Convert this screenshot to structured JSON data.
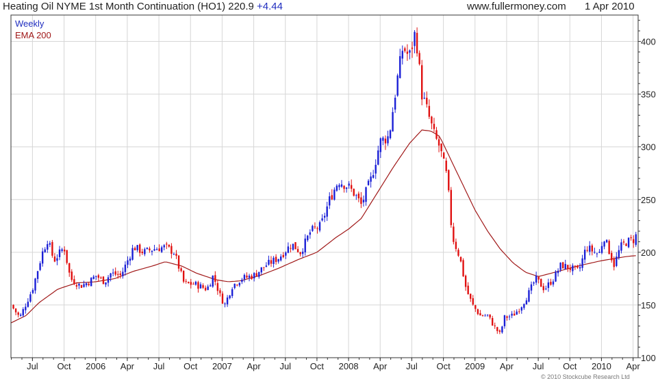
{
  "header": {
    "title": "Heating Oil NYME 1st Month Continuation (HO1) 220.9",
    "change": "+4.44",
    "site": "www.fullermoney.com",
    "date": "1 Apr 2010"
  },
  "copyright": "© 2010 Stockcube Research Ltd",
  "colors": {
    "up": "#1a1fd6",
    "down": "#e01010",
    "ema": "#a01818",
    "grid": "#d6d6d6",
    "legend_weekly": "#1f2dbf",
    "legend_ema": "#a01818"
  },
  "chart_data": {
    "type": "candlestick",
    "frequency": "weekly",
    "ylim": [
      100,
      425
    ],
    "yticks": [
      100,
      150,
      200,
      250,
      300,
      350,
      400
    ],
    "x_range": [
      2005.33,
      2010.29
    ],
    "grid": true,
    "legend_position": "top-left",
    "xticks": [
      {
        "label": "Jul",
        "t": 2005.5
      },
      {
        "label": "Oct",
        "t": 2005.75
      },
      {
        "label": "2006",
        "t": 2006.0
      },
      {
        "label": "Apr",
        "t": 2006.25
      },
      {
        "label": "Jul",
        "t": 2006.5
      },
      {
        "label": "Oct",
        "t": 2006.75
      },
      {
        "label": "2007",
        "t": 2007.0
      },
      {
        "label": "Apr",
        "t": 2007.25
      },
      {
        "label": "Jul",
        "t": 2007.5
      },
      {
        "label": "Oct",
        "t": 2007.75
      },
      {
        "label": "2008",
        "t": 2008.0
      },
      {
        "label": "Apr",
        "t": 2008.25
      },
      {
        "label": "Jul",
        "t": 2008.5
      },
      {
        "label": "Oct",
        "t": 2008.75
      },
      {
        "label": "2009",
        "t": 2009.0
      },
      {
        "label": "Apr",
        "t": 2009.25
      },
      {
        "label": "Jul",
        "t": 2009.5
      },
      {
        "label": "Oct",
        "t": 2009.75
      },
      {
        "label": "2010",
        "t": 2010.0
      },
      {
        "label": "Apr",
        "t": 2010.25
      }
    ],
    "price_path": [
      [
        2005.33,
        150
      ],
      [
        2005.4,
        138
      ],
      [
        2005.5,
        165
      ],
      [
        2005.58,
        200
      ],
      [
        2005.62,
        212
      ],
      [
        2005.67,
        192
      ],
      [
        2005.75,
        205
      ],
      [
        2005.8,
        175
      ],
      [
        2005.88,
        168
      ],
      [
        2005.95,
        172
      ],
      [
        2006.0,
        178
      ],
      [
        2006.07,
        172
      ],
      [
        2006.12,
        180
      ],
      [
        2006.2,
        178
      ],
      [
        2006.3,
        205
      ],
      [
        2006.38,
        200
      ],
      [
        2006.45,
        203
      ],
      [
        2006.55,
        205
      ],
      [
        2006.62,
        200
      ],
      [
        2006.7,
        170
      ],
      [
        2006.78,
        170
      ],
      [
        2006.88,
        165
      ],
      [
        2006.93,
        178
      ],
      [
        2006.98,
        160
      ],
      [
        2007.02,
        150
      ],
      [
        2007.08,
        168
      ],
      [
        2007.15,
        175
      ],
      [
        2007.25,
        178
      ],
      [
        2007.35,
        188
      ],
      [
        2007.45,
        195
      ],
      [
        2007.55,
        208
      ],
      [
        2007.62,
        200
      ],
      [
        2007.7,
        220
      ],
      [
        2007.78,
        225
      ],
      [
        2007.85,
        250
      ],
      [
        2007.92,
        268
      ],
      [
        2008.0,
        262
      ],
      [
        2008.05,
        255
      ],
      [
        2008.1,
        245
      ],
      [
        2008.18,
        270
      ],
      [
        2008.25,
        305
      ],
      [
        2008.32,
        310
      ],
      [
        2008.38,
        360
      ],
      [
        2008.43,
        395
      ],
      [
        2008.48,
        385
      ],
      [
        2008.53,
        410
      ],
      [
        2008.58,
        350
      ],
      [
        2008.62,
        335
      ],
      [
        2008.68,
        310
      ],
      [
        2008.72,
        300
      ],
      [
        2008.78,
        270
      ],
      [
        2008.82,
        215
      ],
      [
        2008.88,
        195
      ],
      [
        2008.93,
        165
      ],
      [
        2008.98,
        150
      ],
      [
        2009.04,
        140
      ],
      [
        2009.1,
        140
      ],
      [
        2009.16,
        128
      ],
      [
        2009.2,
        122
      ],
      [
        2009.23,
        138
      ],
      [
        2009.3,
        140
      ],
      [
        2009.36,
        148
      ],
      [
        2009.42,
        160
      ],
      [
        2009.48,
        175
      ],
      [
        2009.55,
        165
      ],
      [
        2009.62,
        175
      ],
      [
        2009.68,
        188
      ],
      [
        2009.75,
        185
      ],
      [
        2009.82,
        182
      ],
      [
        2009.88,
        205
      ],
      [
        2009.92,
        202
      ],
      [
        2009.98,
        198
      ],
      [
        2010.02,
        215
      ],
      [
        2010.05,
        205
      ],
      [
        2010.1,
        188
      ],
      [
        2010.15,
        205
      ],
      [
        2010.2,
        210
      ],
      [
        2010.26,
        212
      ],
      [
        2010.29,
        220.9
      ]
    ],
    "ema_path": [
      [
        2005.33,
        133
      ],
      [
        2005.45,
        140
      ],
      [
        2005.55,
        152
      ],
      [
        2005.7,
        165
      ],
      [
        2005.85,
        171
      ],
      [
        2006.0,
        172
      ],
      [
        2006.15,
        175
      ],
      [
        2006.3,
        182
      ],
      [
        2006.45,
        187
      ],
      [
        2006.55,
        191
      ],
      [
        2006.68,
        187
      ],
      [
        2006.8,
        180
      ],
      [
        2006.95,
        174
      ],
      [
        2007.05,
        172
      ],
      [
        2007.15,
        173
      ],
      [
        2007.3,
        178
      ],
      [
        2007.45,
        185
      ],
      [
        2007.6,
        193
      ],
      [
        2007.75,
        200
      ],
      [
        2007.9,
        214
      ],
      [
        2008.0,
        222
      ],
      [
        2008.1,
        232
      ],
      [
        2008.22,
        255
      ],
      [
        2008.35,
        280
      ],
      [
        2008.48,
        303
      ],
      [
        2008.58,
        316
      ],
      [
        2008.65,
        315
      ],
      [
        2008.72,
        310
      ],
      [
        2008.8,
        290
      ],
      [
        2008.9,
        265
      ],
      [
        2009.0,
        240
      ],
      [
        2009.1,
        220
      ],
      [
        2009.2,
        203
      ],
      [
        2009.3,
        190
      ],
      [
        2009.4,
        181
      ],
      [
        2009.5,
        177
      ],
      [
        2009.6,
        180
      ],
      [
        2009.72,
        184
      ],
      [
        2009.85,
        188
      ],
      [
        2010.0,
        192
      ],
      [
        2010.1,
        194
      ],
      [
        2010.2,
        196
      ],
      [
        2010.29,
        197
      ]
    ],
    "last_close": 220.9,
    "change": 4.44,
    "legend": [
      {
        "label": "Weekly"
      },
      {
        "label": "EMA 200"
      }
    ]
  }
}
